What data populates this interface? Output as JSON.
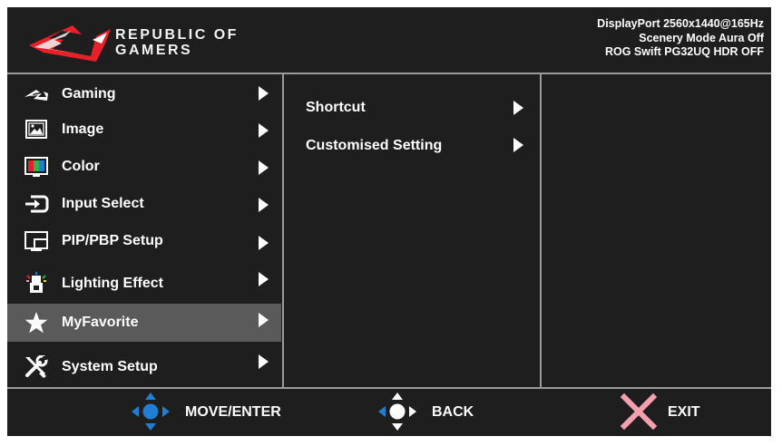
{
  "header": {
    "brand_line1": "REPUBLIC OF",
    "brand_line2": "GAMERS",
    "status_line1": "DisplayPort 2560x1440@165Hz",
    "status_line2": "Scenery Mode Aura Off",
    "status_line3": "ROG Swift PG32UQ HDR OFF"
  },
  "main_menu": {
    "items": [
      {
        "label": "Gaming",
        "icon": "rog-eye-icon"
      },
      {
        "label": "Image",
        "icon": "image-icon"
      },
      {
        "label": "Color",
        "icon": "color-icon"
      },
      {
        "label": "Input Select",
        "icon": "input-select-icon"
      },
      {
        "label": "PIP/PBP Setup",
        "icon": "pip-pbp-icon"
      },
      {
        "label": "Lighting Effect",
        "icon": "lighting-effect-icon"
      },
      {
        "label": "MyFavorite",
        "icon": "star-icon"
      },
      {
        "label": "System Setup",
        "icon": "wrench-screwdriver-icon"
      }
    ],
    "selected": "MyFavorite"
  },
  "sub_menu": {
    "items": [
      {
        "label": "Shortcut"
      },
      {
        "label": "Customised Setting"
      }
    ]
  },
  "footer": {
    "move_label": "MOVE/ENTER",
    "back_label": "BACK",
    "exit_label": "EXIT"
  },
  "colors": {
    "background": "#1e1e1e",
    "selected_row": "#5a5a5a",
    "divider": "#9a9a9a",
    "logo_red": "#e8202a",
    "joystick_blue": "#1f7fd3",
    "exit_pink": "#f2a0b0"
  }
}
